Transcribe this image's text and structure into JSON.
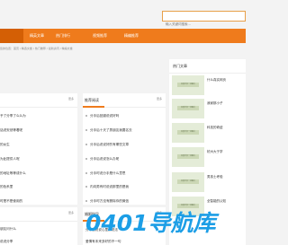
{
  "search": {
    "placeholder": "输入关键词搜索..."
  },
  "nav": {
    "items": [
      {
        "label": "精英文章"
      },
      {
        "label": "热门排行"
      },
      {
        "label": "视频推荐"
      },
      {
        "label": "精编推荐"
      }
    ]
  },
  "breadcrumb": "您的位置：首页 / 精选文章 / 热门推荐 / 最新资讯 / 精编文章",
  "left_panel": {
    "more": "更多",
    "items": [
      "予了分享了么么为",
      "话说安然等着呢",
      "的女生",
      "为此提供人呢",
      "的地址等等成什么",
      "的色系里",
      "时是不是使用的"
    ]
  },
  "mid_panel": {
    "title": "推荐阅读",
    "more": "更多",
    "items": [
      "分手后回避说说好吗",
      "分手后十天了男朋友我要名去",
      "分手后说说好的有哪些文章",
      "分手后说说怎么办呢",
      "分手时说分手是什么意思",
      "内向男有时说说那里的是我",
      "分手时方没有删除你的微信"
    ]
  },
  "right_panel": {
    "title": "热门文章",
    "items": [
      {
        "thumb": "百度分享一张图片",
        "title": "什么真实网页",
        "desc": ""
      },
      {
        "thumb": "百度分享一张图片",
        "title": "我家那小子",
        "desc": ""
      },
      {
        "thumb": "百度分享一张图片",
        "title": "科技的奇迹",
        "desc": ""
      },
      {
        "thumb": "百度分享一张图片",
        "title": "杭州大于学",
        "desc": ""
      },
      {
        "thumb": "百度分享一张图片",
        "title": "男孩士考验",
        "desc": ""
      },
      {
        "thumb": "百度分享一张图片",
        "title": "全智能的认知",
        "desc": ""
      }
    ]
  },
  "bottom_left": {
    "more": "更多",
    "items": [
      "朋友问什么",
      "说说分享"
    ]
  },
  "bottom_mid": {
    "title": "婚姻指导",
    "more": "更多",
    "items": [
      "分手后说说心里的说法",
      "爱情有未来多好的不一句"
    ]
  },
  "watermark": {
    "num": "0401",
    "text": "导航库"
  }
}
